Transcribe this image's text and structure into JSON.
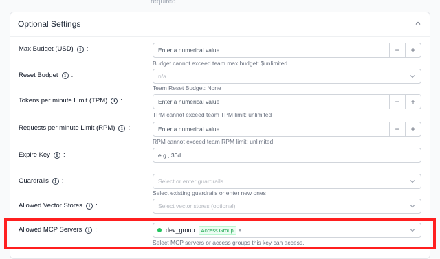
{
  "top_hint": "required",
  "section": {
    "title": "Optional Settings"
  },
  "fields": {
    "max_budget": {
      "label": "Max Budget (USD)",
      "placeholder": "Enter a numerical value",
      "help": "Budget cannot exceed team max budget: $unlimited",
      "minus": "−",
      "plus": "+"
    },
    "reset_budget": {
      "label": "Reset Budget",
      "value": "n/a",
      "help": "Team Reset Budget: None"
    },
    "tpm": {
      "label": "Tokens per minute Limit (TPM)",
      "placeholder": "Enter a numerical value",
      "help": "TPM cannot exceed team TPM limit: unlimited",
      "minus": "−",
      "plus": "+"
    },
    "rpm": {
      "label": "Requests per minute Limit (RPM)",
      "placeholder": "Enter a numerical value",
      "help": "RPM cannot exceed team RPM limit: unlimited",
      "minus": "−",
      "plus": "+"
    },
    "expire_key": {
      "label": "Expire Key",
      "placeholder": "e.g., 30d"
    },
    "guardrails": {
      "label": "Guardrails",
      "placeholder": "Select or enter guardrails",
      "help": "Select existing guardrails or enter new ones"
    },
    "vector_stores": {
      "label": "Allowed Vector Stores",
      "placeholder": "Select vector stores (optional)"
    },
    "mcp_servers": {
      "label": "Allowed MCP Servers",
      "tag_name": "dev_group",
      "tag_badge": "Access Group",
      "tag_close": "×",
      "help": "Select MCP servers or access groups this key can access."
    }
  },
  "icons": {
    "info": "info-circle-icon",
    "chevron_down": "chevron-down-icon",
    "chevron_up": "chevron-up-icon",
    "status_dot": "green-status-dot"
  },
  "colors": {
    "highlight": "#ff1f1f",
    "status_dot": "#22c55e",
    "badge_text": "#16a34a"
  }
}
